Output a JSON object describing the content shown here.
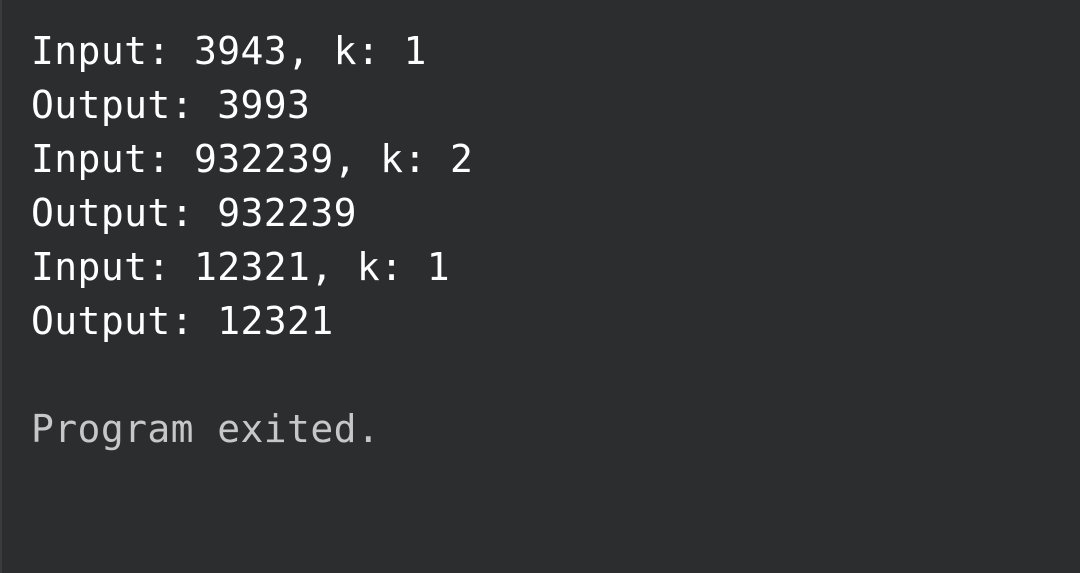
{
  "colors": {
    "background": "#2c2d2f",
    "output_text": "#ffffff",
    "system_text": "#c7c7c7"
  },
  "console": {
    "lines": [
      "Input: 3943, k: 1",
      "Output: 3993",
      "Input: 932239, k: 2",
      "Output: 932239",
      "Input: 12321, k: 1",
      "Output: 12321"
    ],
    "exit_message": "Program exited."
  }
}
